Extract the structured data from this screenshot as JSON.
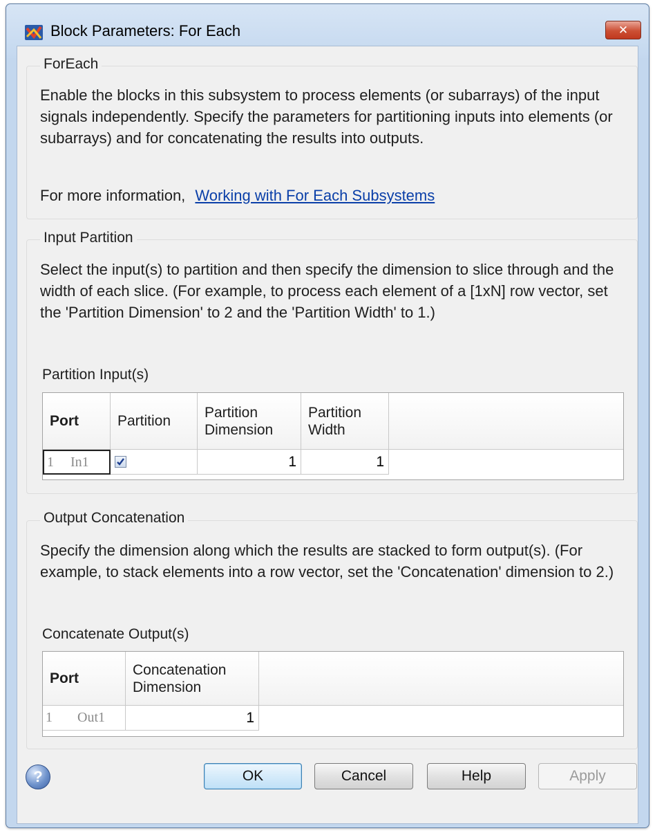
{
  "window": {
    "title": "Block Parameters: For Each",
    "close_symbol": "✕"
  },
  "foreach": {
    "title": "ForEach",
    "description": "Enable the blocks in this subsystem to process elements (or subarrays) of the input signals independently. Specify the parameters for partitioning inputs into elements (or subarrays) and for concatenating the results into outputs.",
    "more_info_prefix": "For more information,",
    "more_info_link": "Working with For Each Subsystems"
  },
  "input_partition": {
    "title": "Input Partition",
    "description": "Select the input(s) to partition and then specify the dimension to slice through and the width of each slice. (For example, to process each element of a [1xN] row vector, set the 'Partition Dimension' to 2 and the 'Partition Width' to 1.)",
    "table_label": "Partition Input(s)",
    "columns": [
      "Port",
      "Partition",
      "Partition Dimension",
      "Partition Width"
    ],
    "rows": [
      {
        "index": "1",
        "port": "In1",
        "partition": true,
        "dimension": "1",
        "width": "1"
      }
    ]
  },
  "output_concatenation": {
    "title": "Output Concatenation",
    "description": "Specify the dimension along which the results are stacked to form output(s). (For example, to stack elements into a row vector, set the 'Concatenation' dimension to 2.)",
    "table_label": "Concatenate Output(s)",
    "columns": [
      "Port",
      "Concatenation Dimension"
    ],
    "rows": [
      {
        "index": "1",
        "port": "Out1",
        "dimension": "1"
      }
    ]
  },
  "footer": {
    "help_icon_glyph": "?",
    "ok": "OK",
    "cancel": "Cancel",
    "help": "Help",
    "apply": "Apply"
  },
  "colors": {
    "window_frame": "#c3d7ee",
    "panel": "#f0f0f0",
    "link": "#0a3fa8",
    "close_button": "#cc4f34"
  }
}
